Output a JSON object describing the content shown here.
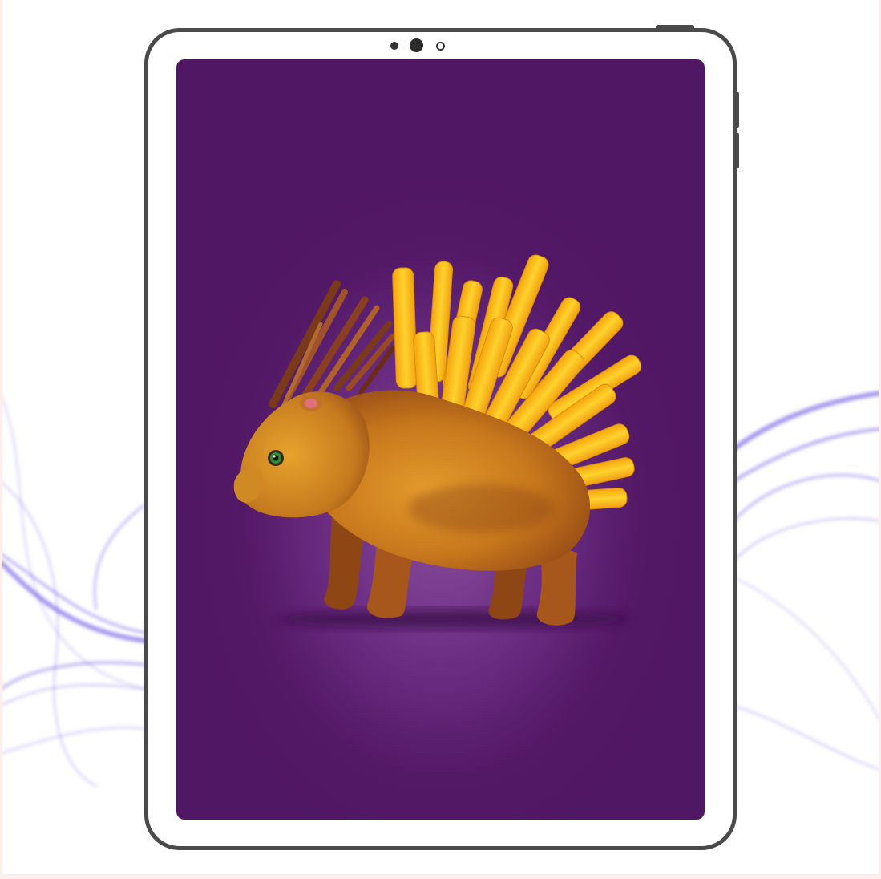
{
  "scene": {
    "device": "tablet",
    "screen_content": "porcupine-with-french-fry-quills",
    "background": "purple-smoke-waves"
  },
  "colors": {
    "screen_bg": "#531866",
    "screen_glow": "#8a4e9c",
    "tablet_bezel": "#ffffff",
    "tablet_outline": "#4a4a4a",
    "wave": "#5b3fe0",
    "fries": "#ffc21a",
    "animal_body": "#c8781c"
  }
}
